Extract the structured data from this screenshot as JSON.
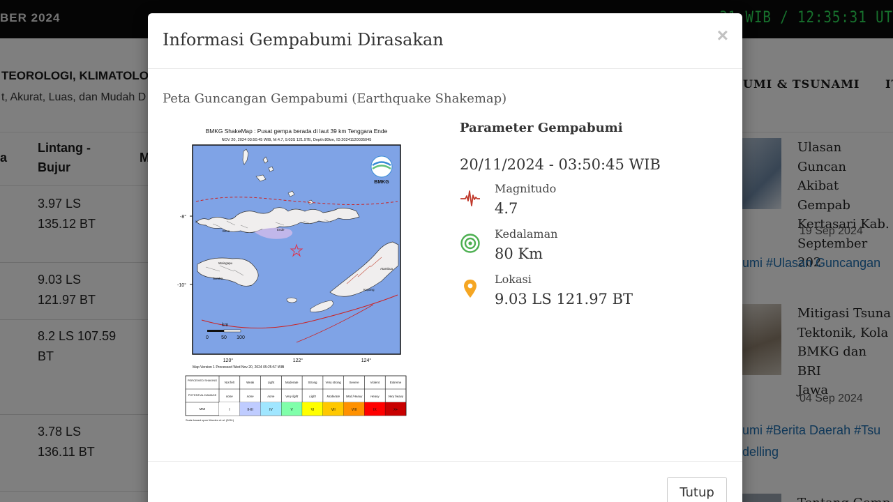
{
  "topbar": {
    "date": "BER 2024",
    "clock": ":31 WIB / 12:35:31 UT"
  },
  "header": {
    "org_name": "TEOROLOGI, KLIMATOLOGI",
    "tagline": "t, Akurat, Luas, dan Mudah D",
    "nav": [
      "UMI & TSUNAMI",
      "IT"
    ]
  },
  "table": {
    "headers": [
      "a",
      "Lintang -\nBujur",
      "M"
    ],
    "rows": [
      "3.97 LS\n135.12 BT",
      "9.03 LS\n121.97 BT",
      "8.2 LS 107.59\nBT",
      "3.78 LS\n136.11 BT"
    ]
  },
  "news": [
    {
      "title": "Ulasan Guncan\nAkibat Gempab\nKertasari Kab.\nSeptember 202",
      "date": "19 Sep 2024",
      "tags": "umi #Ulasan Guncangan"
    },
    {
      "title": "Mitigasi Tsuna\nTektonik, Kola\nBMKG dan BRI\nJawa",
      "date": "04 Sep 2024",
      "tags": "umi #Berita Daerah #Tsu\ndelling"
    },
    {
      "title": "Tentang Gemp"
    }
  ],
  "modal": {
    "title": "Informasi Gempabumi Dirasakan",
    "close_symbol": "×",
    "section_title": "Peta Guncangan Gempabumi (Earthquake Shakemap)",
    "footer_button": "Tutup"
  },
  "shakemap": {
    "title": "BMKG ShakeMap : Pusat gempa berada di laut 39 km Tenggara Ende",
    "subtitle": "NOV 20, 2024 03:50:45 WIB, M:4.7, 9.03S 121.97E, Depth:80km, ID:20241120035045",
    "logo_text": "BMKG",
    "lat_labels": [
      "-8°",
      "-10°"
    ],
    "lon_labels": [
      "120°",
      "122°",
      "124°"
    ],
    "scale_unit": "km",
    "scale_ticks": [
      "0",
      "50",
      "100"
    ],
    "processed_note": "Map Version 1 Processed Wed Nov 20, 2024 05:25:57 WIB",
    "place_labels": [
      "Bima",
      "Ende",
      "Kupang",
      "Sumba",
      "Waingapu",
      "Atambua"
    ],
    "legend": {
      "row_labels": [
        "PERCEIVED SHAKING",
        "POTENTIAL DAMAGE",
        "MMI"
      ],
      "shaking": [
        "Not felt",
        "Weak",
        "Light",
        "Moderate",
        "Strong",
        "Very strong",
        "Severe",
        "Violent",
        "Extreme"
      ],
      "damage": [
        "none",
        "none",
        "none",
        "Very light",
        "Light",
        "Moderate",
        "Mod./Heavy",
        "Heavy",
        "Very heavy"
      ],
      "mmi": [
        "I",
        "II-III",
        "IV",
        "V",
        "VI",
        "VII",
        "VIII",
        "IX",
        "X+"
      ],
      "mmi_colors": [
        "#ffffff",
        "#bfccff",
        "#a0e6ff",
        "#80ffaa",
        "#ffff00",
        "#ffc800",
        "#ff9100",
        "#ff0000",
        "#c80000"
      ],
      "credit": "Scale based upon Worden et al. (2011)"
    }
  },
  "parameters": {
    "heading": "Parameter Gempabumi",
    "datetime": "20/11/2024 - 03:50:45 WIB",
    "magnitude": {
      "label": "Magnitudo",
      "value": "4.7",
      "icon": "seismograph-icon",
      "color": "#c0392b"
    },
    "depth": {
      "label": "Kedalaman",
      "value": "80 Km",
      "icon": "depth-rings-icon",
      "color": "#4caf50"
    },
    "location": {
      "label": "Lokasi",
      "value": "9.03 LS 121.97 BT",
      "icon": "map-pin-icon",
      "color": "#f5a623"
    }
  }
}
